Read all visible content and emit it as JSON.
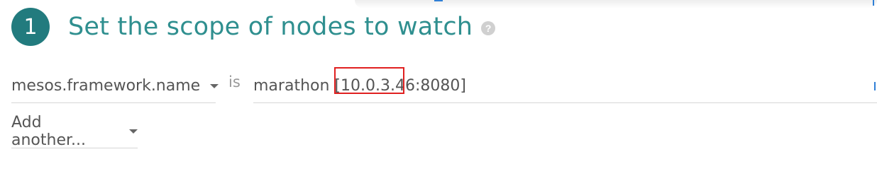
{
  "step": {
    "number": "1",
    "title": "Set the scope of nodes to watch",
    "help_icon": "question-circle-icon"
  },
  "scope": {
    "field": "mesos.framework.name",
    "operator": "is",
    "value": "marathon [10.0.3.46:8080]",
    "add_label": "Add another..."
  },
  "colors": {
    "accent": "#227b7e",
    "title": "#2f8f8f",
    "highlight_box": "#e02020"
  }
}
